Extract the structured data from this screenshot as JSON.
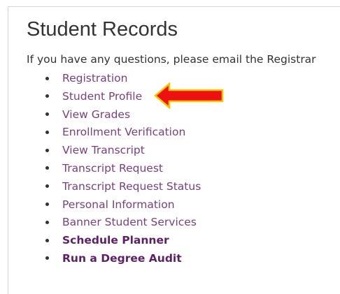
{
  "page": {
    "title": "Student Records",
    "intro_text": "If you have any questions, please email the ",
    "registrar_link": "Registrar"
  },
  "links": [
    {
      "label": "Registration",
      "bold": false
    },
    {
      "label": "Student Profile",
      "bold": false
    },
    {
      "label": "View Grades",
      "bold": false
    },
    {
      "label": "Enrollment Verification",
      "bold": false
    },
    {
      "label": "View Transcript",
      "bold": false
    },
    {
      "label": "Transcript Request",
      "bold": false
    },
    {
      "label": "Transcript Request Status",
      "bold": false
    },
    {
      "label": "Personal Information",
      "bold": false
    },
    {
      "label": "Banner Student Services",
      "bold": false
    },
    {
      "label": "Schedule Planner",
      "bold": true
    },
    {
      "label": "Run a Degree Audit",
      "bold": true
    }
  ],
  "colors": {
    "link": "#7a3f7f",
    "bold_link": "#5e1f68",
    "arrow_fill": "#ee1111",
    "arrow_outline": "#f2c500"
  },
  "annotation": {
    "icon": "red-arrow-pointing-left",
    "points_to": "Student Profile"
  }
}
